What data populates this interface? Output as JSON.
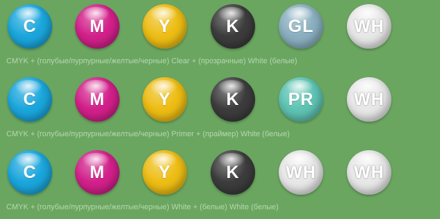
{
  "rows": [
    {
      "balls": [
        {
          "label": "C",
          "name": "cyan",
          "color": "#1aa6dc"
        },
        {
          "label": "M",
          "name": "magenta",
          "color": "#d2208a"
        },
        {
          "label": "Y",
          "name": "yellow",
          "color": "#edbd14"
        },
        {
          "label": "K",
          "name": "black",
          "color": "#3c3c3c"
        },
        {
          "label": "GL",
          "name": "gloss",
          "color": "#8aafbf"
        },
        {
          "label": "WH",
          "name": "white",
          "color": "#e7e7e7"
        }
      ],
      "caption": "CMYK + (голубые/пурпурные/желтые/черные) Clear + (прозрачные) White (белые)"
    },
    {
      "balls": [
        {
          "label": "C",
          "name": "cyan",
          "color": "#1aa6dc"
        },
        {
          "label": "M",
          "name": "magenta",
          "color": "#d2208a"
        },
        {
          "label": "Y",
          "name": "yellow",
          "color": "#edbd14"
        },
        {
          "label": "K",
          "name": "black",
          "color": "#3c3c3c"
        },
        {
          "label": "PR",
          "name": "primer",
          "color": "#5ec3b3"
        },
        {
          "label": "WH",
          "name": "white",
          "color": "#e7e7e7"
        }
      ],
      "caption": "CMYK + (голубые/пурпурные/желтые/черные) Primer + (праймер) White (белые)"
    },
    {
      "balls": [
        {
          "label": "C",
          "name": "cyan",
          "color": "#1aa6dc"
        },
        {
          "label": "M",
          "name": "magenta",
          "color": "#d2208a"
        },
        {
          "label": "Y",
          "name": "yellow",
          "color": "#edbd14"
        },
        {
          "label": "K",
          "name": "black",
          "color": "#3c3c3c"
        },
        {
          "label": "WH",
          "name": "white",
          "color": "#e7e7e7"
        },
        {
          "label": "WH",
          "name": "white",
          "color": "#e7e7e7"
        }
      ],
      "caption": "CMYK + (голубые/пурпурные/желтые/черные) White + (белые) White (белые)"
    }
  ],
  "background_color": "#6aa660"
}
